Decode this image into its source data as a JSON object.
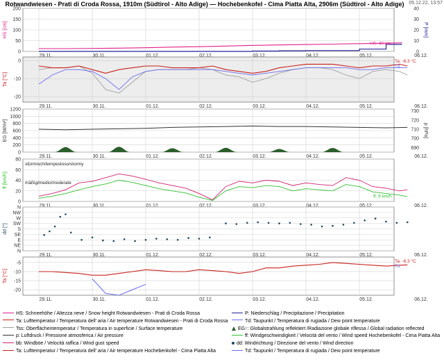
{
  "header": {
    "title": "Rotwandwiesen - Prati di Croda Rossa, 1910m (Südtirol - Alto Adige) — Hochebenkofel - Cima Piatta Alta, 2906m (Südtirol - Alto Adige)",
    "timestamp": "05.12.22, 13:57"
  },
  "colors": {
    "snow": "#e0208a",
    "precip": "#20209a",
    "temp_red": "#c8201a",
    "dew_blue": "#6a6af0",
    "surface_gray": "#a0a0a0",
    "radiation": "#2b5e2b",
    "pressure": "#333333",
    "wind_speed": "#30c030",
    "gust": "#d0206e",
    "wind_dir": "#18485e"
  },
  "chart_data": [
    {
      "type": "line",
      "id": "snow",
      "ylabel": "HS [cm]",
      "y2label": "P [mm]",
      "yticks": [
        0,
        50,
        100,
        150,
        200
      ],
      "ylim": [
        0,
        200
      ],
      "y2ticks": [
        0,
        10,
        20,
        30,
        40
      ],
      "y2lim": [
        0,
        40
      ],
      "x": [
        0,
        0.5,
        1,
        1.5,
        2,
        2.5,
        3,
        3.5,
        4,
        4.5,
        5,
        5.5,
        6,
        6.5,
        6.8
      ],
      "series": [
        {
          "name": "HS",
          "color": "snow",
          "values": [
            13,
            13,
            14,
            15,
            17,
            20,
            22,
            25,
            28,
            30,
            32,
            34,
            36,
            38,
            40
          ]
        },
        {
          "color": "precip",
          "axis": "y2",
          "values": [
            0,
            0,
            0,
            0,
            0,
            0,
            0,
            0,
            0.3,
            0.6,
            0.8,
            0.8,
            2.1,
            6.5,
            6.5
          ]
        }
      ],
      "annotations": [
        "HS: 40 cm"
      ],
      "gridlines": true
    },
    {
      "type": "line",
      "id": "temp-rotwand",
      "ylabel": "Ta [°C]",
      "yticks": [
        0,
        -10,
        -20
      ],
      "ylim": [
        -23,
        2
      ],
      "x": [
        0,
        0.25,
        0.5,
        0.75,
        1,
        1.25,
        1.5,
        1.75,
        2,
        2.25,
        2.5,
        2.75,
        3,
        3.25,
        3.5,
        3.75,
        4,
        4.25,
        4.5,
        4.75,
        5,
        5.25,
        5.5,
        5.75,
        6,
        6.25,
        6.5,
        6.75,
        6.9
      ],
      "series": [
        {
          "name": "Ta",
          "color": "temp_red",
          "values": [
            -3,
            -4,
            -4,
            -3,
            -5,
            -7,
            -5,
            -4,
            -3,
            -3,
            -4,
            -4,
            -4,
            -3,
            -5,
            -6,
            -7,
            -6,
            -4,
            -3,
            -2,
            -2,
            -2,
            -3,
            -4,
            -3,
            -3,
            -2,
            -3
          ]
        },
        {
          "name": "Td",
          "color": "dew_blue",
          "values": [
            -13,
            -8,
            -5,
            -5,
            -6,
            -10,
            -16,
            -9,
            -6,
            -5,
            -5,
            -5,
            -5,
            -5,
            -6,
            -7,
            -8,
            -7,
            -6,
            -5,
            -4,
            -4,
            -4,
            -4,
            -5,
            -5,
            -4,
            -4,
            -4
          ]
        },
        {
          "name": "Tss",
          "color": "surface_gray",
          "values": [
            -5,
            -4,
            -4,
            -3,
            -7,
            -16,
            -18,
            -12,
            -6,
            -5,
            -5,
            -5,
            -4,
            -5,
            -8,
            -9,
            -12,
            -10,
            -7,
            -5,
            -4,
            -4,
            -5,
            -8,
            -10,
            -6,
            -5,
            -6,
            -8
          ]
        }
      ],
      "annotations": [
        "Ta: -6.3 °C",
        "Td"
      ],
      "gridlines": true
    },
    {
      "type": "area",
      "id": "radiation-pressure",
      "ylabel": "EG [W/m²]",
      "y2label": "p [hPa]",
      "yticks": [
        0,
        200,
        400,
        600,
        800,
        1000,
        1200
      ],
      "ylim": [
        0,
        1200
      ],
      "y2ticks": [
        690,
        700,
        710,
        720,
        730
      ],
      "y2lim": [
        685,
        732
      ],
      "radiation_days": [
        0,
        1,
        2,
        3,
        4,
        5,
        6
      ],
      "radiation_peaks": [
        140,
        150,
        110,
        120,
        90,
        115,
        130
      ],
      "pressure_x": [
        0,
        0.5,
        1,
        1.5,
        2,
        2.5,
        3,
        3.5,
        4,
        4.5,
        5,
        5.5,
        6,
        6.5,
        6.9
      ],
      "pressure_values": [
        710,
        709.5,
        710,
        710.5,
        711,
        712,
        712.5,
        713,
        713.5,
        713,
        713,
        712.5,
        712,
        711.5,
        712
      ],
      "gridlines": true
    },
    {
      "type": "line",
      "id": "wind-speed",
      "ylabel": "ff [km/h]",
      "yticks": [
        0,
        20,
        40,
        60,
        80
      ],
      "ylim": [
        0,
        80
      ],
      "x": [
        0,
        0.25,
        0.5,
        0.75,
        1,
        1.25,
        1.5,
        1.75,
        2,
        2.25,
        2.5,
        2.75,
        3,
        3.25,
        3.5,
        3.75,
        4,
        4.25,
        4.5,
        4.75,
        5,
        5.25,
        5.5,
        5.75,
        6,
        6.25,
        6.5,
        6.75,
        6.9
      ],
      "series": [
        {
          "name": "bb",
          "color": "gust",
          "values": [
            10,
            15,
            22,
            35,
            38,
            45,
            52,
            48,
            42,
            35,
            30,
            25,
            15,
            3,
            28,
            38,
            35,
            40,
            38,
            30,
            35,
            32,
            30,
            45,
            40,
            28,
            25,
            20,
            22
          ]
        },
        {
          "name": "ff",
          "color": "wind_speed",
          "values": [
            6,
            10,
            15,
            22,
            28,
            33,
            40,
            36,
            30,
            24,
            20,
            16,
            8,
            2,
            20,
            28,
            26,
            30,
            28,
            20,
            24,
            22,
            20,
            32,
            28,
            18,
            15,
            12,
            9
          ]
        }
      ],
      "annotations": [
        "stürmisch/tempestoso/stormy",
        "mäßig/medio/moderate",
        "ff: 9 km/h"
      ],
      "gridlines": true
    },
    {
      "type": "scatter",
      "id": "wind-dir",
      "ylabel": "dd [°]",
      "ytick_labels": [
        "N",
        "NW",
        "W",
        "SW",
        "S",
        "SE",
        "E",
        "NE",
        "N"
      ],
      "ylim": [
        0,
        360
      ],
      "x": [
        0.1,
        0.2,
        0.3,
        0.4,
        0.5,
        0.6,
        0.8,
        1,
        1.2,
        1.4,
        1.6,
        1.8,
        2,
        2.2,
        2.4,
        2.6,
        2.8,
        3,
        3.2,
        3.5,
        3.7,
        3.9,
        4.1,
        4.3,
        4.5,
        4.7,
        4.9,
        5.1,
        5.3,
        5.5,
        5.7,
        5.9,
        6.1,
        6.3,
        6.5,
        6.7,
        6.9
      ],
      "values": [
        130,
        160,
        200,
        280,
        300,
        150,
        90,
        110,
        85,
        80,
        95,
        80,
        90,
        100,
        95,
        90,
        105,
        100,
        110,
        225,
        220,
        230,
        235,
        230,
        225,
        230,
        220,
        215,
        200,
        205,
        215,
        230,
        250,
        265,
        240,
        230,
        235
      ],
      "gridlines": true
    },
    {
      "type": "line",
      "id": "temp-hochebenkofel",
      "ylabel": "Ta [°C]",
      "yticks": [
        -5,
        -10,
        -15,
        -20
      ],
      "ylim": [
        -23,
        -2
      ],
      "x": [
        0,
        0.25,
        0.5,
        0.75,
        1,
        1.25,
        1.5,
        1.75,
        2,
        2.25,
        2.5,
        2.75,
        3,
        3.25,
        3.5,
        3.75,
        4,
        4.25,
        4.5,
        4.75,
        5,
        5.25,
        5.5,
        5.75,
        6,
        6.25,
        6.5,
        6.75,
        6.9
      ],
      "series": [
        {
          "name": "Ta",
          "color": "temp_red",
          "values": [
            -10,
            -10,
            -10.5,
            -11,
            -12,
            -12,
            -11,
            -10,
            -9,
            -9.5,
            -10,
            -10,
            -9,
            -9.5,
            -10,
            -11,
            -10,
            -8,
            -8,
            -7,
            -6.5,
            -6,
            -5,
            -5.5,
            -6,
            -6.5,
            -7,
            -6.5,
            -6.3
          ]
        },
        {
          "name": "Td",
          "color": "dew_blue",
          "values": [
            null,
            null,
            null,
            null,
            -14,
            -22,
            -23,
            -20,
            -17
          ]
        }
      ],
      "annotations": [
        "Ta: -6.3 °C",
        "Td"
      ],
      "gridlines": true
    }
  ],
  "x_axis": {
    "ticks": [
      "29.11.",
      "30.11.",
      "01.12.",
      "02.12.",
      "03.12.",
      "04.12.",
      "05.12.",
      "06.12."
    ]
  },
  "legend": {
    "rows": [
      [
        {
          "swatch": "line",
          "color": "snow",
          "text": "HS: Schneehöhe / Altezza neve / Snow height  Rotwandwiesen - Prati di Croda Rossa"
        },
        {
          "swatch": "line",
          "color": "precip",
          "text": "P: Niederschlag / Precipitazione / Precipitation"
        }
      ],
      [
        {
          "swatch": "line",
          "color": "temp_red",
          "text": "Ta: Lufttemperatur / Temperatura dell' aria / Air temperature  Rotwandwiesen - Prati di Croda Rossa"
        },
        {
          "swatch": "line",
          "color": "dew_blue",
          "text": "Td: Taupunkt / Temperatura di rugiada / Dew point temperature"
        }
      ],
      [
        {
          "swatch": "line",
          "color": "surface_gray",
          "text": "Tss: Oberflächentemperatur / Temperatura in superficie / Surface temperature"
        },
        {
          "swatch": "tri",
          "color": "radiation",
          "text": "EG↑: Globalstrahlung reflektiert /Radiazione globale riflessa / Global radiation reflected"
        }
      ],
      [
        {
          "swatch": "line",
          "color": "pressure",
          "text": "p: Luftdruck / Pressione atmosferica / Air pressure"
        },
        {
          "swatch": "line",
          "color": "wind_speed",
          "text": "ff: Windgeschwindigkeit / Velocità del vento / Wind speed  Hochebenkofel - Cima Piatta Alta"
        }
      ],
      [
        {
          "swatch": "line",
          "color": "gust",
          "text": "bb: Windböe / Velocità raffica / Wind gust speed"
        },
        {
          "swatch": "dot",
          "color": "wind_dir",
          "text": "dd: Windrichtung / Direzione del vento / Wind direction"
        }
      ],
      [
        {
          "swatch": "line",
          "color": "temp_red",
          "text": "Ta: Lufttemperatur / Temperatura dell' aria / Air temperature  Hochebenkofel - Cima Piatta Alta"
        },
        {
          "swatch": "line",
          "color": "dew_blue",
          "text": "Td: Taupunkt / Temperatura di rugiada / Dew point temperature"
        }
      ]
    ]
  }
}
